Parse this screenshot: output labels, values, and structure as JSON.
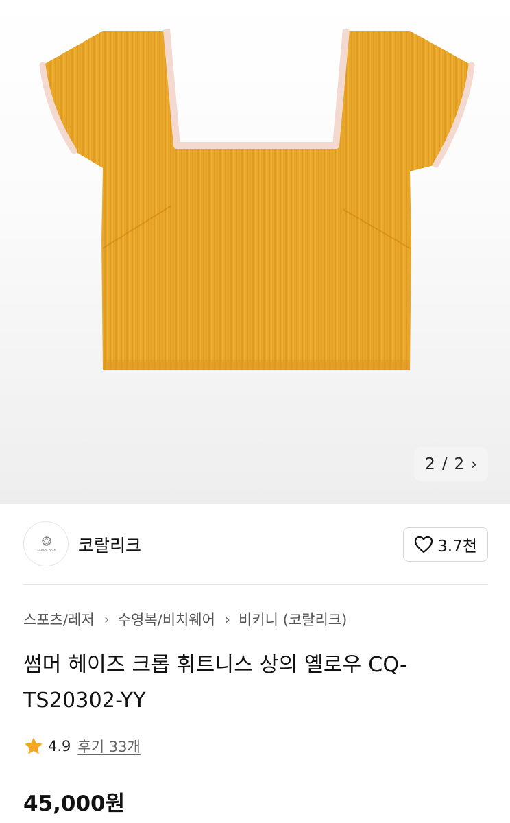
{
  "gallery": {
    "current": "2",
    "separator": "/",
    "total": "2",
    "image_alt": "yellow ribbed square-neck crop top"
  },
  "seller": {
    "name": "코랄리크",
    "logo_text": "CORAL RICK",
    "likes_label": "3.7천"
  },
  "breadcrumb": {
    "items": [
      "스포츠/레저",
      "수영복/비치웨어",
      "비키니 (코랄리크)"
    ]
  },
  "product": {
    "title": "썸머 헤이즈 크롭 휘트니스 상의 옐로우 CQ-TS20302-YY",
    "rating": "4.9",
    "reviews_label": "후기 33개",
    "price": "45,000원"
  },
  "colors": {
    "fabric": "#E9A72A",
    "trim": "#F3D9CF",
    "star": "#F5A623"
  }
}
